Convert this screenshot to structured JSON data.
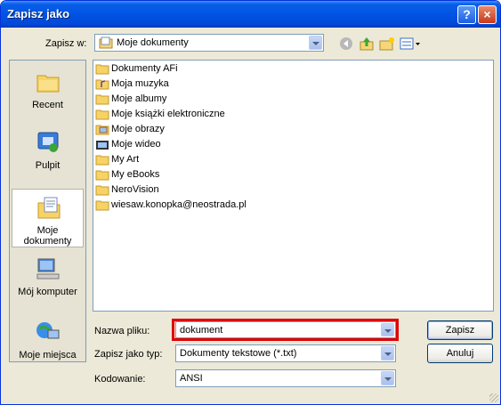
{
  "window": {
    "title": "Zapisz jako",
    "help_label": "?",
    "close_label": "×"
  },
  "save_in": {
    "label": "Zapisz w:",
    "value": "Moje dokumenty"
  },
  "places": [
    {
      "label": "Recent",
      "icon": "recent-folder-icon"
    },
    {
      "label": "Pulpit",
      "icon": "desktop-icon"
    },
    {
      "label": "Moje dokumenty",
      "icon": "my-documents-icon",
      "selected": true
    },
    {
      "label": "Mój komputer",
      "icon": "my-computer-icon"
    },
    {
      "label": "Moje miejsca",
      "icon": "network-places-icon"
    }
  ],
  "files": [
    {
      "name": "Dokumenty AFi",
      "icon": "folder-icon"
    },
    {
      "name": "Moja muzyka",
      "icon": "music-folder-icon"
    },
    {
      "name": "Moje albumy",
      "icon": "folder-icon"
    },
    {
      "name": "Moje książki elektroniczne",
      "icon": "folder-icon"
    },
    {
      "name": "Moje obrazy",
      "icon": "pictures-folder-icon"
    },
    {
      "name": "Moje wideo",
      "icon": "video-folder-icon"
    },
    {
      "name": "My Art",
      "icon": "folder-icon"
    },
    {
      "name": "My eBooks",
      "icon": "folder-icon"
    },
    {
      "name": "NeroVision",
      "icon": "folder-icon"
    },
    {
      "name": "wiesaw.konopka@neostrada.pl",
      "icon": "folder-icon"
    }
  ],
  "filename": {
    "label": "Nazwa pliku:",
    "value": "dokument"
  },
  "filetype": {
    "label": "Zapisz jako typ:",
    "value": "Dokumenty tekstowe (*.txt)"
  },
  "encoding": {
    "label": "Kodowanie:",
    "value": "ANSI"
  },
  "buttons": {
    "save": "Zapisz",
    "cancel": "Anuluj"
  },
  "colors": {
    "titlebar": "#0054e3",
    "highlight": "#e00000",
    "dialog_bg": "#ece9d8"
  }
}
